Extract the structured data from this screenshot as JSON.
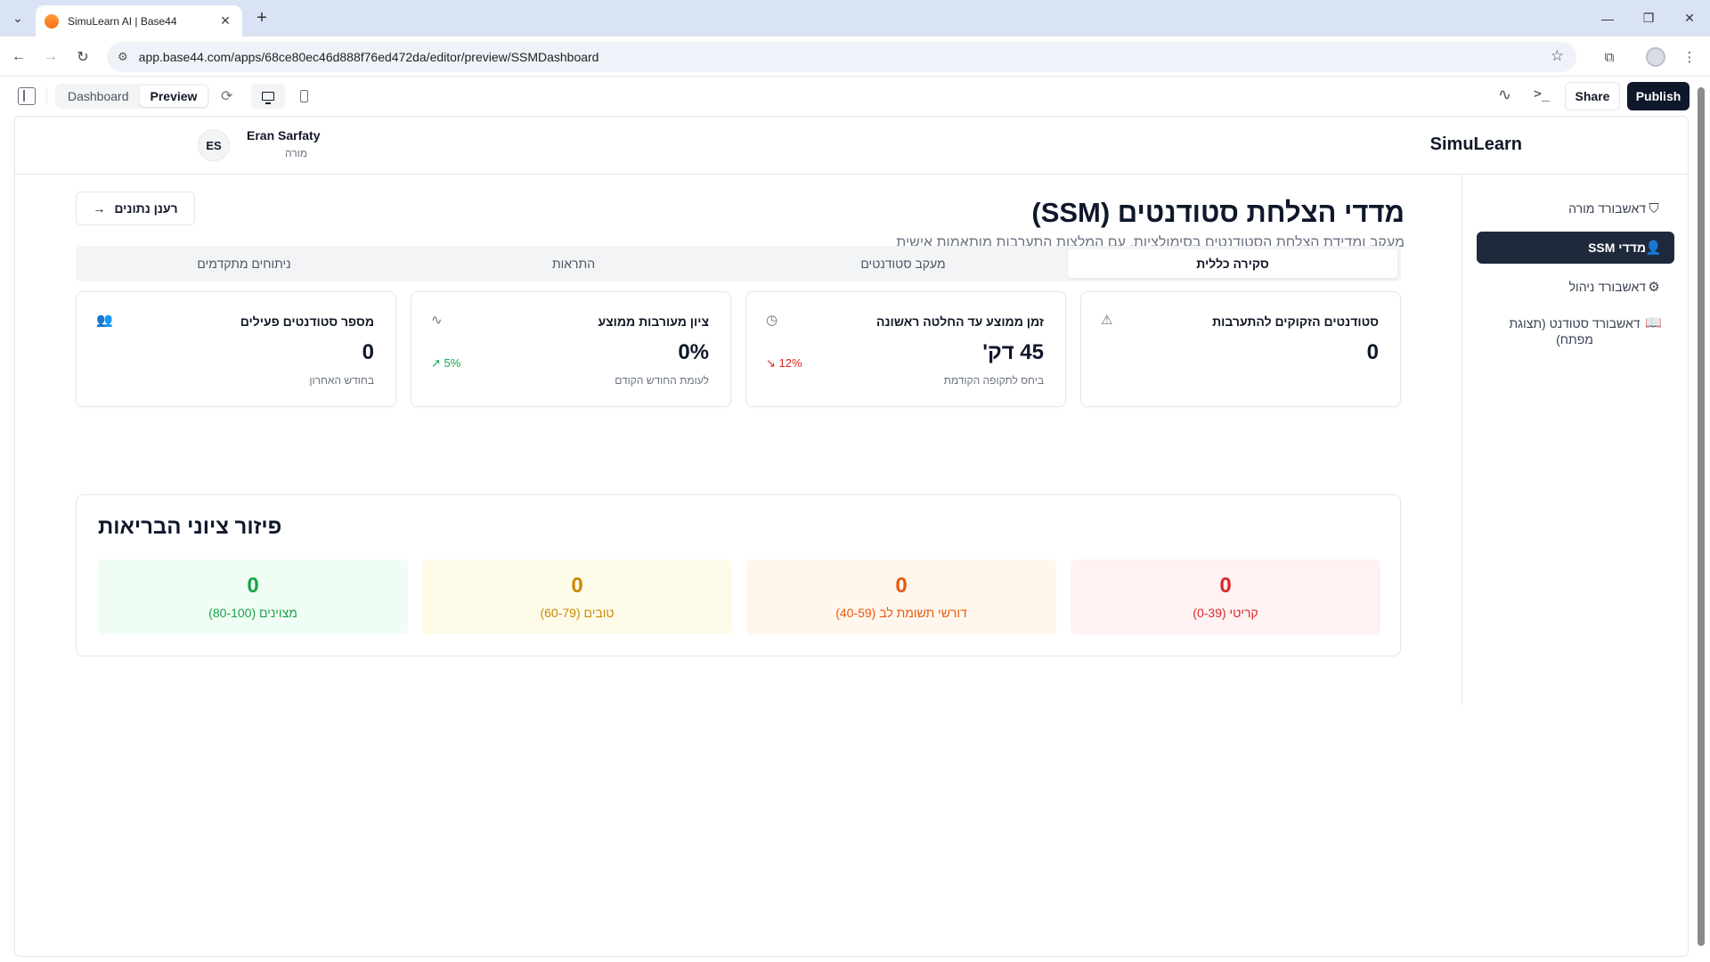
{
  "browser": {
    "tab_title": "SimuLearn AI | Base44",
    "url": "app.base44.com/apps/68ce80ec46d888f76ed472da/editor/preview/SSMDashboard"
  },
  "builder": {
    "dashboard_label": "Dashboard",
    "preview_label": "Preview",
    "share_label": "Share",
    "publish_label": "Publish"
  },
  "header": {
    "avatar_initials": "ES",
    "user_name": "Eran Sarfaty",
    "user_role": "מורה",
    "brand": "SimuLearn"
  },
  "sidebar": {
    "items": [
      {
        "label": "דאשבורד מורה",
        "icon": "shield-icon",
        "active": false
      },
      {
        "label": "מדדי SSM",
        "icon": "user-check-icon",
        "active": true
      },
      {
        "label": "דאשבורד ניהול",
        "icon": "gear-icon",
        "active": false
      },
      {
        "label": "דאשבורד סטודנט (תצוגת מפתח)",
        "icon": "book-open-icon",
        "active": false
      }
    ]
  },
  "page": {
    "title": "מדדי הצלחת סטודנטים (SSM)",
    "subtitle": "מעקב ומדידת הצלחת הסטודנטים בסימולציות, עם המלצות התערבות מותאמות אישית",
    "refresh_label": "רענן נתונים"
  },
  "tabs": [
    {
      "label": "סקירה כללית",
      "active": true
    },
    {
      "label": "מעקב סטודנטים",
      "active": false
    },
    {
      "label": "התראות",
      "active": false
    },
    {
      "label": "ניתוחים מתקדמים",
      "active": false
    }
  ],
  "cards": [
    {
      "title": "סטודנטים הזקוקים להתערבות",
      "icon": "alert-triangle-icon",
      "value": "0",
      "sub": "",
      "trend": ""
    },
    {
      "title": "זמן ממוצע עד החלטה ראשונה",
      "icon": "clock-icon",
      "value": "45 דק'",
      "sub": "ביחס לתקופה הקודמת",
      "trend": "12%",
      "trend_dir": "down"
    },
    {
      "title": "ציון מעורבות ממוצע",
      "icon": "activity-icon",
      "value": "0%",
      "sub": "לעומת החודש הקודם",
      "trend": "5%",
      "trend_dir": "up"
    },
    {
      "title": "מספר סטודנטים פעילים",
      "icon": "users-icon",
      "value": "0",
      "sub": "בחודש האחרון",
      "trend": ""
    }
  ],
  "distribution": {
    "title": "פיזור ציוני הבריאות",
    "groups": [
      {
        "value": "0",
        "label": "קריטי (0-39)",
        "color": "#dc2626",
        "bg": "#fef2f2"
      },
      {
        "value": "0",
        "label": "דורשי תשומת לב (40-59)",
        "color": "#ea580c",
        "bg": "#fff7ed"
      },
      {
        "value": "0",
        "label": "טובים (60-79)",
        "color": "#ca8a04",
        "bg": "#fefce8"
      },
      {
        "value": "0",
        "label": "מצוינים (80-100)",
        "color": "#16a34a",
        "bg": "#f0fdf4"
      }
    ]
  }
}
